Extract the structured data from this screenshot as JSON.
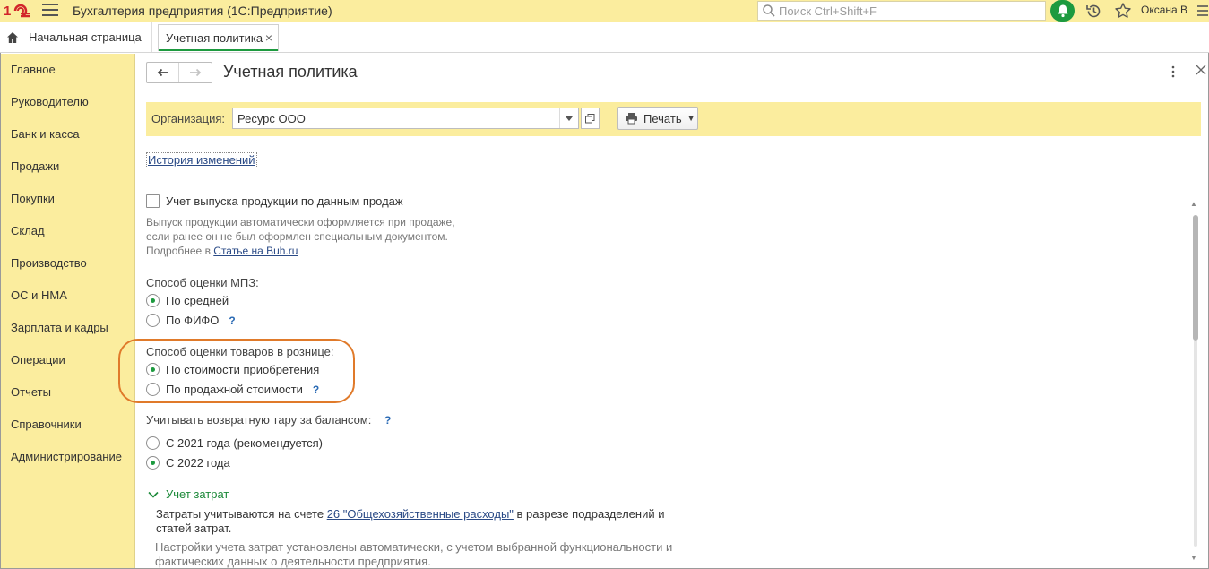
{
  "app": {
    "title": "Бухгалтерия предприятия  (1С:Предприятие)",
    "search_placeholder": "Поиск Ctrl+Shift+F",
    "user": "Оксана В"
  },
  "tabs": {
    "home": "Начальная страница",
    "active": "Учетная политика"
  },
  "sidebar": {
    "items": [
      {
        "label": "Главное"
      },
      {
        "label": "Руководителю"
      },
      {
        "label": "Банк и касса"
      },
      {
        "label": "Продажи"
      },
      {
        "label": "Покупки"
      },
      {
        "label": "Склад"
      },
      {
        "label": "Производство"
      },
      {
        "label": "ОС и НМА"
      },
      {
        "label": "Зарплата и кадры"
      },
      {
        "label": "Операции"
      },
      {
        "label": "Отчеты"
      },
      {
        "label": "Справочники"
      },
      {
        "label": "Администрирование"
      }
    ]
  },
  "form": {
    "title": "Учетная политика",
    "org_label": "Организация:",
    "org_value": "Ресурс ООО",
    "print_label": "Печать",
    "history_link": "История изменений",
    "product_release": {
      "label": "Учет выпуска продукции по данным продаж",
      "checked": false,
      "hint_line1": "Выпуск продукции автоматически оформляется при продаже,",
      "hint_line2": "если ранее он не был оформлен специальным документом.",
      "hint_line3_prefix": "Подробнее в ",
      "hint_link": "Статье на Buh.ru"
    },
    "mpz": {
      "label": "Способ оценки МПЗ:",
      "options": [
        "По средней",
        "По ФИФО"
      ],
      "selected": "По средней"
    },
    "retail": {
      "label": "Способ оценки товаров в рознице:",
      "options": [
        "По стоимости приобретения",
        "По продажной стоимости"
      ],
      "selected": "По стоимости приобретения"
    },
    "tare": {
      "label": "Учитывать возвратную тару за балансом:",
      "options": [
        "С 2021 года (рекомендуется)",
        "С 2022 года"
      ],
      "selected": "С 2022 года"
    },
    "help_mark": "?",
    "costs": {
      "header": "Учет затрат",
      "text_prefix": "Затраты учитываются на счете ",
      "text_link": "26 \"Общехозяйственные расходы\"",
      "text_suffix_line1": " в разрезе подразделений и",
      "text_line2": "статей затрат.",
      "hint_line1": "Настройки учета затрат установлены автоматически, с учетом выбранной функциональности и",
      "hint_line2": "фактических данных о деятельности предприятия."
    }
  },
  "colors": {
    "panel_yellow": "#fbed9e",
    "accent_green": "#1d9a3f",
    "highlight_orange": "#e07a2a",
    "link_blue": "#2a4a86"
  }
}
